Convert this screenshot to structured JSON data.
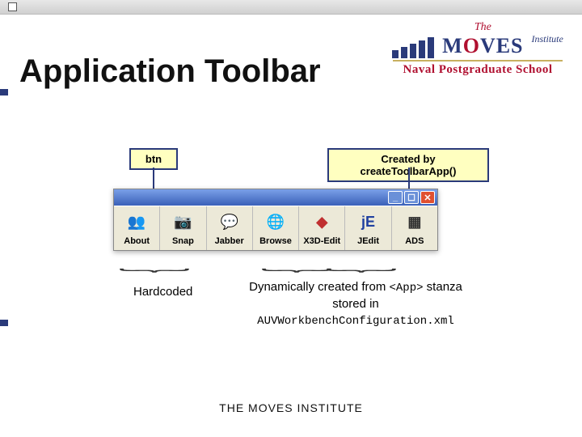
{
  "logo": {
    "the": "The",
    "moves_pre": "M",
    "moves_o": "O",
    "moves_post": "VES",
    "institute": "Institute",
    "nps": "Naval Postgraduate School"
  },
  "title": "Application Toolbar",
  "annot": {
    "btn": "btn",
    "create": "Created by createToolbarApp()"
  },
  "window": {
    "min": "_",
    "max": "☐",
    "close": "✕"
  },
  "toolbar": {
    "items": [
      {
        "label": "About",
        "icon": "👥",
        "color": "#d08030"
      },
      {
        "label": "Snap",
        "icon": "📷",
        "color": "#606060"
      },
      {
        "label": "Jabber",
        "icon": "💬",
        "color": "#f0b030"
      },
      {
        "label": "Browse",
        "icon": "🌐",
        "color": "#3060c0"
      },
      {
        "label": "X3D-Edit",
        "icon": "◆",
        "color": "#c03030"
      },
      {
        "label": "JEdit",
        "icon": "jE",
        "color": "#2040a0"
      },
      {
        "label": "ADS",
        "icon": "▦",
        "color": "#303030"
      }
    ]
  },
  "notes": {
    "hardcoded": "Hardcoded",
    "dyn_pre": "Dynamically created from ",
    "dyn_app": "<App>",
    "dyn_mid": " stanza stored in ",
    "dyn_file": "AUVWorkbenchConfiguration.xml"
  },
  "footer": "THE MOVES INSTITUTE"
}
